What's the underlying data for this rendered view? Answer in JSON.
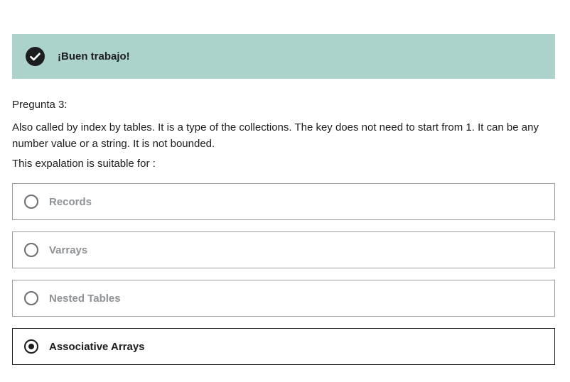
{
  "feedback": {
    "icon": "check-circle-icon",
    "message": "¡Buen trabajo!",
    "background_color": "#acd2cc"
  },
  "question": {
    "number_label": "Pregunta 3:",
    "body": "Also called by index by tables. It is a type of the collections. The key does not need to start from 1. It can be any number value or a string. It is not bounded.",
    "prompt": "This expalation is suitable for :"
  },
  "options": [
    {
      "label": "Records",
      "selected": false
    },
    {
      "label": "Varrays",
      "selected": false
    },
    {
      "label": "Nested Tables",
      "selected": false
    },
    {
      "label": "Associative Arrays",
      "selected": true
    }
  ]
}
